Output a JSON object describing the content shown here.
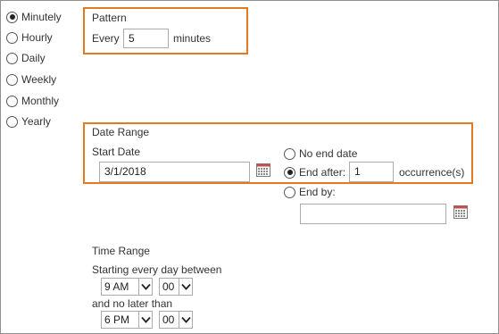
{
  "recurrence": {
    "options": [
      {
        "label": "Minutely",
        "checked": true
      },
      {
        "label": "Hourly",
        "checked": false
      },
      {
        "label": "Daily",
        "checked": false
      },
      {
        "label": "Weekly",
        "checked": false
      },
      {
        "label": "Monthly",
        "checked": false
      },
      {
        "label": "Yearly",
        "checked": false
      }
    ]
  },
  "pattern": {
    "title": "Pattern",
    "every_label": "Every",
    "every_value": "5",
    "unit_label": "minutes"
  },
  "date_range": {
    "title": "Date Range",
    "start_label": "Start Date",
    "start_value": "3/1/2018",
    "no_end_label": "No end date",
    "end_after_label": "End after:",
    "end_after_value": "1",
    "occurrences_label": "occurrence(s)",
    "end_by_label": "End by:",
    "end_by_value": "",
    "end_choice": "end_after"
  },
  "time_range": {
    "title": "Time Range",
    "starting_label": "Starting every day between",
    "start_hour": "9 AM",
    "start_minute": "00",
    "no_later_label": "and no later than",
    "end_hour": "6 PM",
    "end_minute": "00"
  },
  "colors": {
    "highlight": "#e07b22",
    "border": "#8f8f8f",
    "input_border": "#ababab",
    "calendar_accent": "#c0504d"
  },
  "icons": {
    "calendar": "calendar-icon",
    "dropdown": "chevron-down-icon"
  }
}
